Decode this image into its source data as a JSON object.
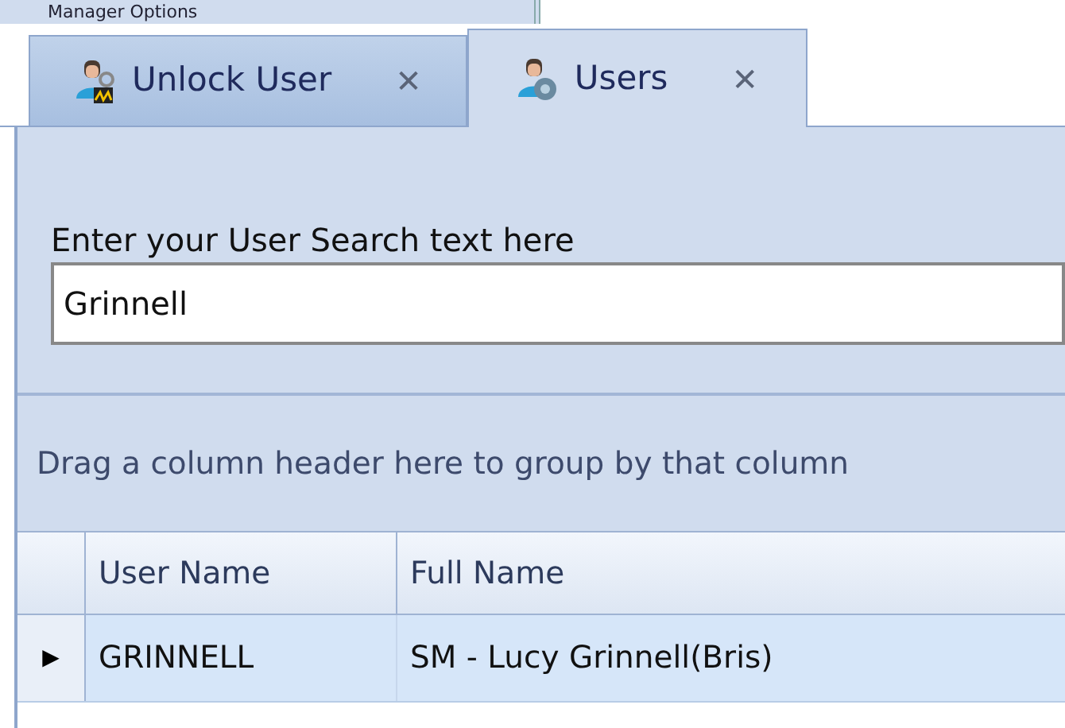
{
  "top_item": {
    "label": "Manager Options"
  },
  "tabs": [
    {
      "label": "Unlock User",
      "kind": "unlock",
      "selected": false,
      "close": "✕"
    },
    {
      "label": "Users",
      "kind": "users",
      "selected": true,
      "close": "✕"
    }
  ],
  "search": {
    "label": "Enter your User Search text here",
    "value": "Grinnell"
  },
  "grid": {
    "group_panel": "Drag a column header here to group by that column",
    "columns": [
      "User Name",
      "Full Name"
    ],
    "rows": [
      {
        "selected": true,
        "marker": "▶",
        "cells": [
          "GRINNELL",
          "SM - Lucy Grinnell(Bris)"
        ]
      }
    ]
  }
}
